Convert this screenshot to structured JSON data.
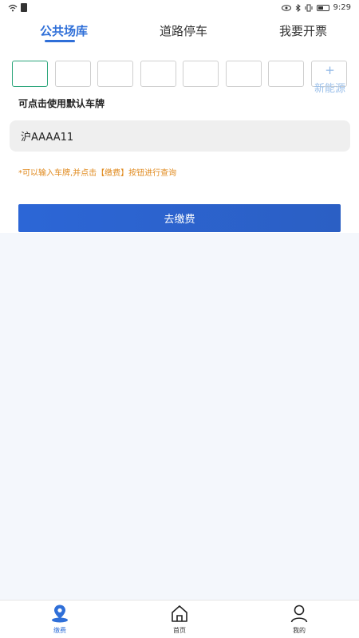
{
  "status_bar": {
    "time": "9:29"
  },
  "tabs": [
    {
      "label": "公共场库",
      "active": true
    },
    {
      "label": "道路停车",
      "active": false
    },
    {
      "label": "我要开票",
      "active": false
    }
  ],
  "plate_entry": {
    "plus_symbol": "+",
    "new_energy_label": "新能源"
  },
  "default_plate": {
    "label": "可点击使用默认车牌",
    "value": "沪AAAA11"
  },
  "hint_text": "*可以输入车牌,并点击【缴费】按钮进行查询",
  "pay_button_label": "去缴费",
  "bottom_nav": [
    {
      "label": "缴费",
      "icon": "pay-location-icon",
      "active": true
    },
    {
      "label": "首页",
      "icon": "home-icon",
      "active": false
    },
    {
      "label": "我的",
      "icon": "user-icon",
      "active": false
    }
  ],
  "colors": {
    "accent": "#2f6fd8",
    "hint": "#e08a1e",
    "active_box_border": "#2aa57a",
    "content_background": "#f4f7fc"
  }
}
